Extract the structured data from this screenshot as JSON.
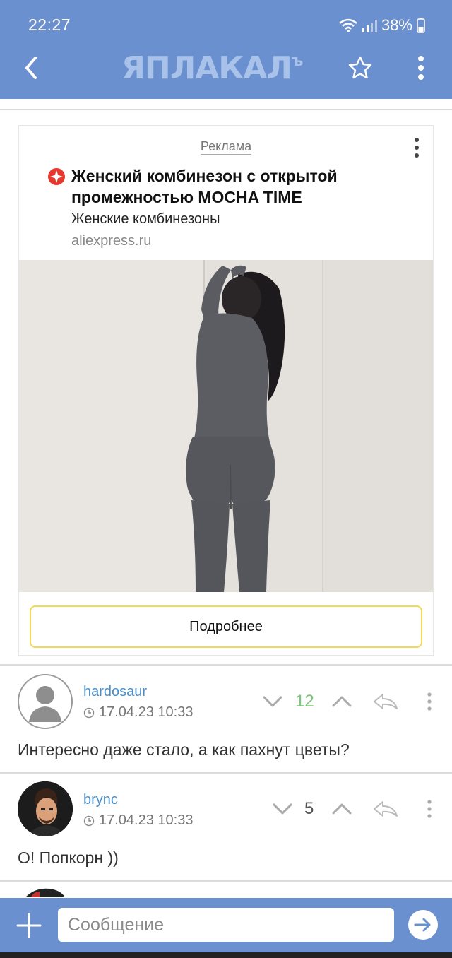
{
  "status_bar": {
    "time": "22:27",
    "battery": "38%"
  },
  "header": {
    "logo_text": "ЯПЛАКАЛ",
    "logo_suffix": "ъ"
  },
  "ad": {
    "label": "Реклама",
    "title": "Женский комбинезон с открытой промежностью MOCHA TIME",
    "subtitle": "Женские комбинезоны",
    "domain": "aliexpress.ru",
    "button_label": "Подробнее"
  },
  "comments": [
    {
      "username": "hardosaur",
      "timestamp": "17.04.23 10:33",
      "score": "12",
      "score_color": "#7dc47b",
      "text": "Интересно даже стало, а как пахнут цветы?"
    },
    {
      "username": "brync",
      "timestamp": "17.04.23 10:33",
      "score": "5",
      "score_color": "#555555",
      "text": "О! Попкорн ))"
    }
  ],
  "composer": {
    "placeholder": "Сообщение"
  },
  "colors": {
    "header": "#6a90cf",
    "username": "#4a8ec8",
    "ad_button_border": "#f0dc52"
  }
}
